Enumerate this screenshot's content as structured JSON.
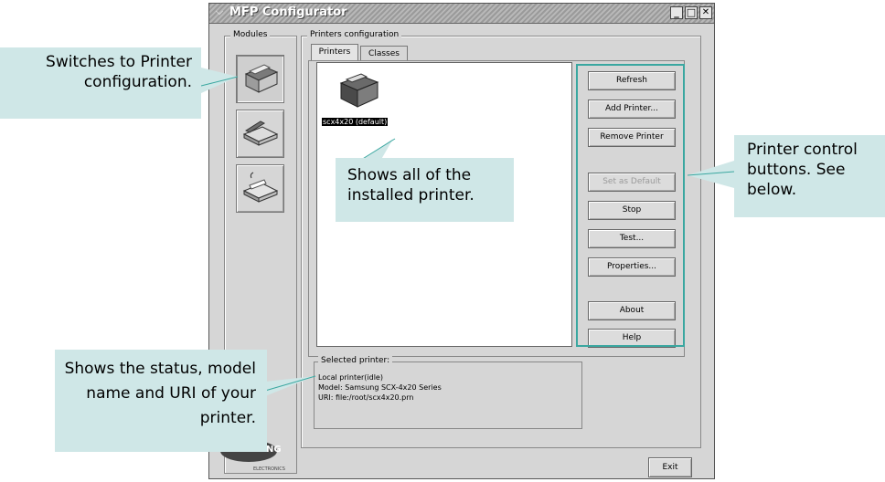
{
  "window": {
    "title": "MFP Configurator",
    "menu_glyph": "⌵",
    "minimize_glyph": "_",
    "maximize_glyph": "□",
    "close_glyph": "✕"
  },
  "modules": {
    "label": "Modules",
    "items": [
      {
        "icon": "printer-icon"
      },
      {
        "icon": "scanner-icon"
      },
      {
        "icon": "fax-icon"
      }
    ]
  },
  "printers_config": {
    "label": "Printers configuration",
    "tabs": [
      "Printers",
      "Classes"
    ],
    "printers": [
      {
        "name": "scx4x20 (default)",
        "icon": "printer-icon"
      }
    ]
  },
  "buttons": {
    "refresh": "Refresh",
    "add_printer": "Add Printer...",
    "remove_printer": "Remove Printer",
    "set_default": "Set as Default",
    "stop": "Stop",
    "test": "Test...",
    "properties": "Properties...",
    "about": "About",
    "help": "Help",
    "exit": "Exit"
  },
  "selected_printer": {
    "label": "Selected printer:",
    "status": "Local printer(idle)",
    "model": "Model: Samsung SCX-4x20 Series",
    "uri": "URI: file:/root/scx4x20.prn"
  },
  "logo": {
    "text": "NG",
    "subtext": "ELECTRONICS"
  },
  "callouts": {
    "switch": "Switches to Printer configuration.",
    "installed": "Shows all of the installed printer.",
    "control": "Printer control buttons. See below.",
    "status": "Shows the status, model name and URI of your printer."
  },
  "colors": {
    "callout_bg": "#cfe7e7",
    "highlight": "#3aa7a0"
  }
}
